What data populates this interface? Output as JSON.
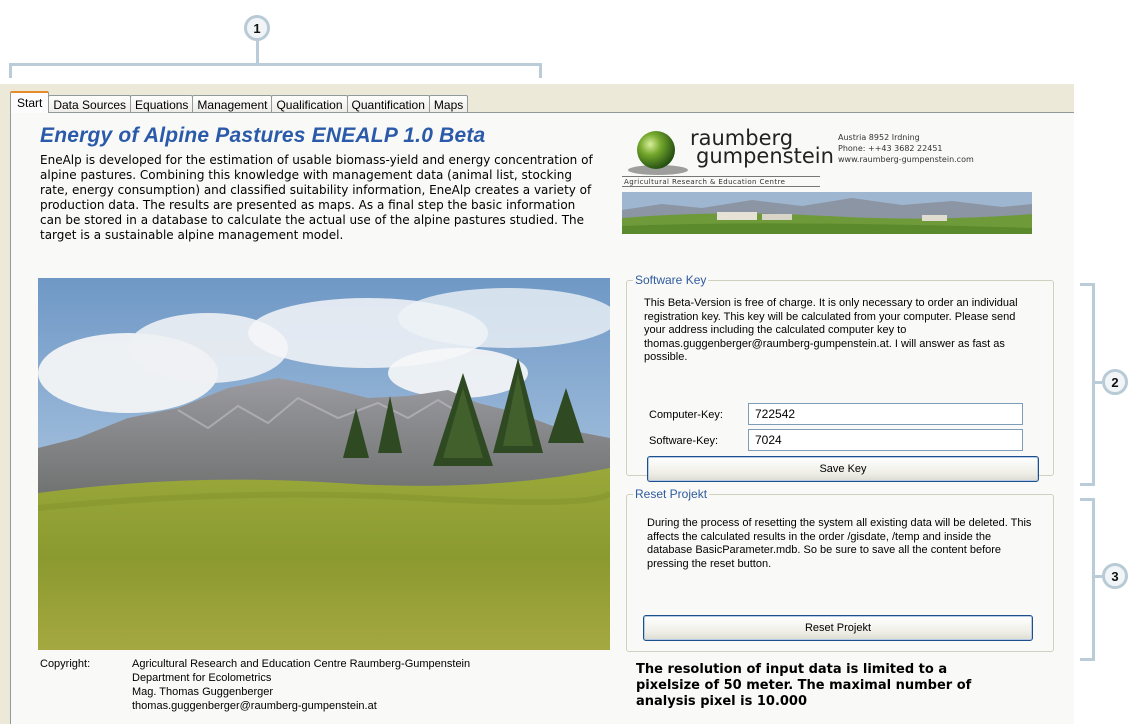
{
  "callouts": [
    "1",
    "2",
    "3"
  ],
  "tabs": [
    {
      "label": "Start",
      "active": true
    },
    {
      "label": "Data Sources"
    },
    {
      "label": "Equations"
    },
    {
      "label": "Management"
    },
    {
      "label": "Qualification"
    },
    {
      "label": "Quantification"
    },
    {
      "label": "Maps"
    }
  ],
  "title": "Energy of Alpine Pastures ENEALP 1.0 Beta",
  "intro": "EneAlp is developed for the estimation of usable biomass-yield and energy concentration of alpine pastures. Combining this knowledge with management data (animal list, stocking rate, energy consumption) and classified suitability information, EneAlp creates a variety of production data. The results are presented as maps. As a final step the basic information can be stored in a database to calculate the actual use of the alpine pastures studied. The target is a sustainable alpine management model.",
  "logo": {
    "line1": "raumberg",
    "line2": "gumpenstein",
    "subtitle": "Agricultural Research & Education Centre",
    "address": [
      "Austria 8952 Irdning",
      "Phone: ++43 3682 22451",
      "www.raumberg-gumpenstein.com"
    ]
  },
  "software_key": {
    "legend": "Software Key",
    "text": "This Beta-Version is free of charge. It is only necessary to order an individual registration key. This key will be calculated from your computer.  Please send your address including the calculated computer key to thomas.guggenberger@raumberg-gumpenstein.at. I will answer as fast as possible.",
    "computer_key_label": "Computer-Key:",
    "computer_key_value": "722542",
    "software_key_label": "Software-Key:",
    "software_key_value": "7024",
    "save_label": "Save Key"
  },
  "reset": {
    "legend": "Reset Projekt",
    "text": "During the process of resetting the system all existing data will be deleted. This affects the calculated results in the order /gisdate, /temp and inside the database BasicParameter.mdb. So be sure to save all the content before pressing the reset button.",
    "button_label": "Reset Projekt"
  },
  "copyright": {
    "label": "Copyright:",
    "lines": [
      "Agricultural Research and Education Centre Raumberg-Gumpenstein",
      "Department for Ecolometrics",
      "Mag. Thomas Guggenberger",
      "thomas.guggenberger@raumberg-gumpenstein.at"
    ]
  },
  "notice": [
    "The resolution of input data is limited to a",
    "pixelsize of 50 meter. The maximal number of",
    "analysis pixel  is 10.000"
  ],
  "colors": {
    "title": "#2a5aa9",
    "legend": "#2f5ba0",
    "active_tab_accent": "#e68b2c",
    "callout_ring": "#b7cad6"
  }
}
